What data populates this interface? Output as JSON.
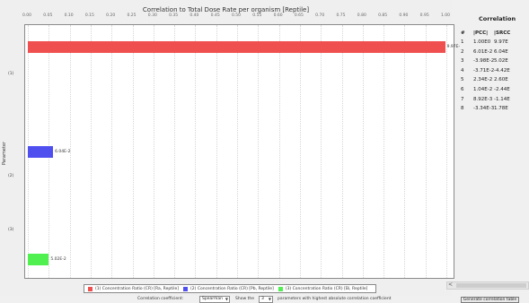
{
  "chart_data": {
    "type": "bar",
    "orientation": "horizontal",
    "title": "Correlation to Total Dose Rate per organism [Reptile]",
    "ylabel": "Parameter",
    "xlabel": "",
    "xlim": [
      0,
      1.0
    ],
    "xticks": [
      "0.00",
      "0.05",
      "0.10",
      "0.15",
      "0.20",
      "0.25",
      "0.30",
      "0.35",
      "0.40",
      "0.45",
      "0.50",
      "0.55",
      "0.60",
      "0.65",
      "0.70",
      "0.75",
      "0.80",
      "0.85",
      "0.90",
      "0.95",
      "1.00"
    ],
    "categories": [
      "(1)",
      "(2)",
      "(3)"
    ],
    "values": [
      0.997,
      0.0604,
      0.0502
    ],
    "value_labels": [
      "9.97E-1",
      "6.04E-2",
      "5.02E-2"
    ],
    "colors": [
      "#f04f4f",
      "#4f4ff0",
      "#4ff04f"
    ],
    "legend": [
      "(1) Concentration Ratio (CR) [Ra, Reptile]",
      "(2) Concentration Ratio (CR) [Pb, Reptile]",
      "(3) Concentration Ratio (CR) [Bi, Reptile]"
    ],
    "legend_position": "bottom",
    "grid": true
  },
  "table": {
    "title": "Correlation",
    "headers": [
      "#",
      "|PCC|",
      "|SRCC"
    ],
    "rows": [
      [
        "1",
        "1.00E0",
        "9.97E"
      ],
      [
        "2",
        "6.01E-2",
        "6.04E"
      ],
      [
        "3",
        "-3.98E-2",
        "5.02E"
      ],
      [
        "4",
        "-3.71E-2",
        "-4.42E"
      ],
      [
        "5",
        "2.34E-2",
        "2.60E"
      ],
      [
        "6",
        "1.04E-2",
        "-2.44E"
      ],
      [
        "7",
        "8.92E-3",
        "-1.14E"
      ],
      [
        "8",
        "-3.34E-3",
        "1.78E"
      ]
    ]
  },
  "controls": {
    "coefficient_label": "Correlation coefficient:",
    "coefficient_value": "Spearman",
    "show_label": "Show the",
    "show_value": "3",
    "suffix_label": "parameters with highest absolute correlation coefficient",
    "generate_button": "Generate correlation table"
  },
  "scrollbar": {
    "left_arrow": "<"
  }
}
